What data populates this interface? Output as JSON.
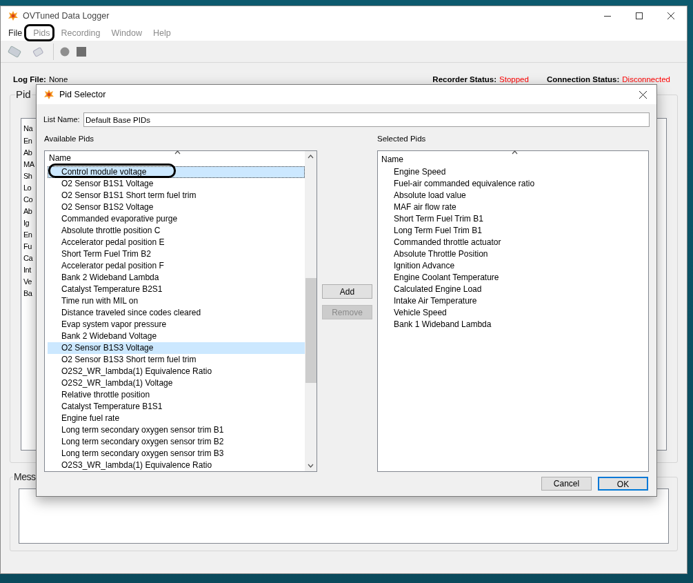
{
  "window": {
    "title": "OVTuned Data Logger"
  },
  "menu": [
    {
      "label": "File",
      "disabled": false
    },
    {
      "label": "Pids",
      "disabled": true
    },
    {
      "label": "Recording",
      "disabled": true
    },
    {
      "label": "Window",
      "disabled": true
    },
    {
      "label": "Help",
      "disabled": true
    }
  ],
  "status_bar": {
    "log_file": {
      "label": "Log File:",
      "value": "None"
    },
    "statuses": [
      {
        "label": "Recorder Status:",
        "value": "Stopped",
        "color": "#ff0000"
      },
      {
        "label": "Connection Status:",
        "value": "Disconnected",
        "color": "#ff0000"
      }
    ]
  },
  "pid_panel": {
    "title": "Pid",
    "header": "Na",
    "rows": [
      "En",
      "Ab",
      "MA",
      "Sh",
      "Lo",
      "Co",
      "Ab",
      "Ig",
      "En",
      "Fu",
      "Ca",
      "Int",
      "Ve",
      "Ba"
    ]
  },
  "messages_panel": {
    "title": "Mess"
  },
  "dialog": {
    "title": "Pid Selector",
    "list_name": {
      "label": "List Name:",
      "value": "Default Base PIDs"
    },
    "available": {
      "label": "Available Pids",
      "header": "Name",
      "rows": [
        {
          "name": "Control module voltage",
          "selected": true,
          "focused": true
        },
        {
          "name": "O2 Sensor B1S1 Voltage",
          "selected": false,
          "focused": false
        },
        {
          "name": "O2 Sensor B1S1 Short term fuel trim",
          "selected": false,
          "focused": false
        },
        {
          "name": "O2 Sensor B1S2 Voltage",
          "selected": false,
          "focused": false
        },
        {
          "name": "Commanded evaporative purge",
          "selected": false,
          "focused": false
        },
        {
          "name": "Absolute throttle position C",
          "selected": false,
          "focused": false
        },
        {
          "name": "Accelerator pedal position E",
          "selected": false,
          "focused": false
        },
        {
          "name": "Short Term Fuel Trim B2",
          "selected": false,
          "focused": false
        },
        {
          "name": "Accelerator pedal position F",
          "selected": false,
          "focused": false
        },
        {
          "name": "Bank 2 Wideband Lambda",
          "selected": false,
          "focused": false
        },
        {
          "name": "Catalyst Temperature B2S1",
          "selected": false,
          "focused": false
        },
        {
          "name": "Time run with MIL on",
          "selected": false,
          "focused": false
        },
        {
          "name": "Distance traveled since codes cleared",
          "selected": false,
          "focused": false
        },
        {
          "name": "Evap system vapor pressure",
          "selected": false,
          "focused": false
        },
        {
          "name": "Bank 2 Wideband Voltage",
          "selected": false,
          "focused": false
        },
        {
          "name": "O2 Sensor B1S3 Voltage",
          "selected": true,
          "focused": false
        },
        {
          "name": "O2 Sensor B1S3 Short term fuel trim",
          "selected": false,
          "focused": false
        },
        {
          "name": "O2S2_WR_lambda(1) Equivalence Ratio",
          "selected": false,
          "focused": false
        },
        {
          "name": "O2S2_WR_lambda(1) Voltage",
          "selected": false,
          "focused": false
        },
        {
          "name": "Relative throttle position",
          "selected": false,
          "focused": false
        },
        {
          "name": "Catalyst Temperature B1S1",
          "selected": false,
          "focused": false
        },
        {
          "name": "Engine fuel rate",
          "selected": false,
          "focused": false
        },
        {
          "name": "Long term secondary oxygen sensor trim B1",
          "selected": false,
          "focused": false
        },
        {
          "name": "Long term secondary oxygen sensor trim B2",
          "selected": false,
          "focused": false
        },
        {
          "name": "Long term secondary oxygen sensor trim B3",
          "selected": false,
          "focused": false
        },
        {
          "name": "O2S3_WR_lambda(1) Equivalence Ratio",
          "selected": false,
          "focused": false
        }
      ]
    },
    "transfer_buttons": [
      {
        "label": "Add",
        "disabled": false
      },
      {
        "label": "Remove",
        "disabled": true
      }
    ],
    "selected_list": {
      "label": "Selected Pids",
      "header": "Name",
      "rows": [
        "Engine Speed",
        "Fuel-air commanded equivalence ratio",
        "Absolute load value",
        "MAF air flow rate",
        "Short Term Fuel Trim B1",
        "Long Term Fuel Trim B1",
        "Commanded throttle actuator",
        "Absolute Throttle Position",
        "Ignition Advance",
        "Engine Coolant Temperature",
        "Calculated Engine Load",
        "Intake Air Temperature",
        "Vehicle Speed",
        "Bank 1 Wideband Lambda"
      ]
    },
    "buttons": [
      {
        "label": "Cancel",
        "default": false
      },
      {
        "label": "OK",
        "default": true
      }
    ]
  }
}
